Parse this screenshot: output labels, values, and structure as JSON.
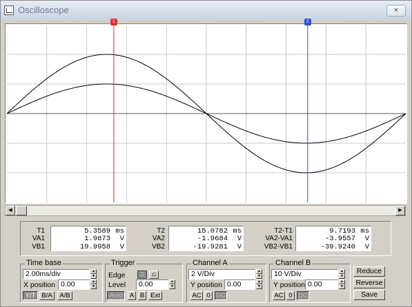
{
  "window": {
    "title": "Oscilloscope",
    "close_icon": "×"
  },
  "cursors": [
    {
      "label": "1",
      "color": "#e03030",
      "time_ms": 5.3589
    },
    {
      "label": "2",
      "color": "#3050d0",
      "time_ms": 15.0782
    }
  ],
  "chart_data": {
    "type": "line",
    "xlabel": "",
    "ylabel": "",
    "xlim_ms": [
      0,
      20.0
    ],
    "x_divisions": 10,
    "y_divisions": 6,
    "grid": true,
    "series": [
      {
        "channel": "A",
        "volts_per_div": 2,
        "amplitude": 2,
        "frequency_hz": 50,
        "phase_deg": 0
      },
      {
        "channel": "B",
        "volts_per_div": 10,
        "amplitude": 20,
        "frequency_hz": 50,
        "phase_deg": 0
      }
    ],
    "colors": {
      "trace": "#000000",
      "grid": "#c8c8c8",
      "background": "#ffffff"
    }
  },
  "readouts": {
    "t1": {
      "label": "T1",
      "value": "5.3589",
      "unit": "ms"
    },
    "va1": {
      "label": "VA1",
      "value": "1.9873",
      "unit": "V"
    },
    "vb1": {
      "label": "VB1",
      "value": "19.9958",
      "unit": "V"
    },
    "t2": {
      "label": "T2",
      "value": "15.0782",
      "unit": "ms"
    },
    "va2": {
      "label": "VA2",
      "value": "-1.9684",
      "unit": "V"
    },
    "vb2": {
      "label": "VB2",
      "value": "-19.9281",
      "unit": "V"
    },
    "dt": {
      "label": "T2-T1",
      "value": "9.7193",
      "unit": "ms"
    },
    "dva": {
      "label": "VA2-VA1",
      "value": "-3.9557",
      "unit": "V"
    },
    "dvb": {
      "label": "VB2-VB1",
      "value": "-39.9240",
      "unit": "V"
    }
  },
  "timebase": {
    "group": "Time base",
    "scale": "2.00ms/div",
    "xpos_label": "X position",
    "xpos": "0.00",
    "modes": [
      "Y/T",
      "B/A",
      "A/B"
    ]
  },
  "trigger": {
    "group": "Trigger",
    "edge_label": "Edge",
    "level_label": "Level",
    "level": "0.00",
    "rising_icon": "⎍",
    "falling_icon": "⎌",
    "sources": [
      "Auto",
      "A",
      "B",
      "Ext"
    ]
  },
  "channel_a": {
    "group": "Channel A",
    "scale": "2 V/Div",
    "ypos_label": "Y position",
    "ypos": "0.00",
    "coupling": [
      "AC",
      "0",
      "DC"
    ]
  },
  "channel_b": {
    "group": "Channel B",
    "scale": "10 V/Div",
    "ypos_label": "Y position",
    "ypos": "0.00",
    "coupling": [
      "AC",
      "0",
      "DC"
    ]
  },
  "actions": {
    "reduce": "Reduce",
    "reverse": "Reverse",
    "save": "Save"
  }
}
